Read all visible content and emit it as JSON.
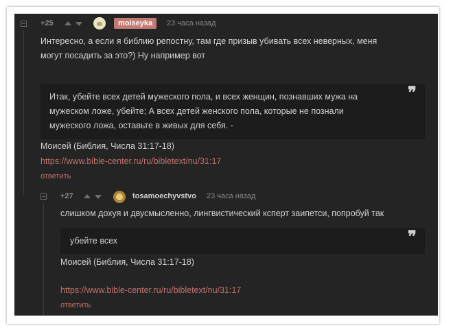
{
  "comment1": {
    "rating": "+25",
    "username": "moiseyka",
    "time": "23 часа назад",
    "text_line1": "Интересно, а если я библию репостну, там где призыв убивать всех неверных, меня",
    "text_line2": "могут посадить за это?) Ну например вот",
    "quote_line1": "Итак, убейте всех детей мужеского пола, и всех женщин, познавших мужа на",
    "quote_line2": "мужеском ложе, убейте; А всех детей женского пола, которые не познали",
    "quote_line3": "мужеского ложа, оставьте в живых для себя. -",
    "quote_mark": "❞",
    "source": "Моисей (Библия, Числа 31:17-18)",
    "link": "https://www.bible-center.ru/ru/bibletext/nu/31:17",
    "reply": "ответить"
  },
  "comment2": {
    "rating": "+27",
    "username": "tosamoechyvstvo",
    "time": "23 часа назад",
    "text": "слишком дохуя и двусмысленно, лингвистический ксперт заипетси, попробуй так",
    "quote": "убейте всех",
    "quote_mark": "❞",
    "source": "Моисей (Библия, Числа 31:17-18)",
    "link": "https://www.bible-center.ru/ru/bibletext/nu/31:17",
    "reply": "ответить"
  },
  "colors": {
    "background": "#242424",
    "quote_background": "#1c1c1c",
    "accent": "#c0716a",
    "username_badge": "#c27a73",
    "text": "#d3d3d3"
  },
  "icons": [
    "collapse-icon",
    "upvote-arrow-icon",
    "downvote-arrow-icon",
    "avatar-icon",
    "quote-mark-icon"
  ]
}
